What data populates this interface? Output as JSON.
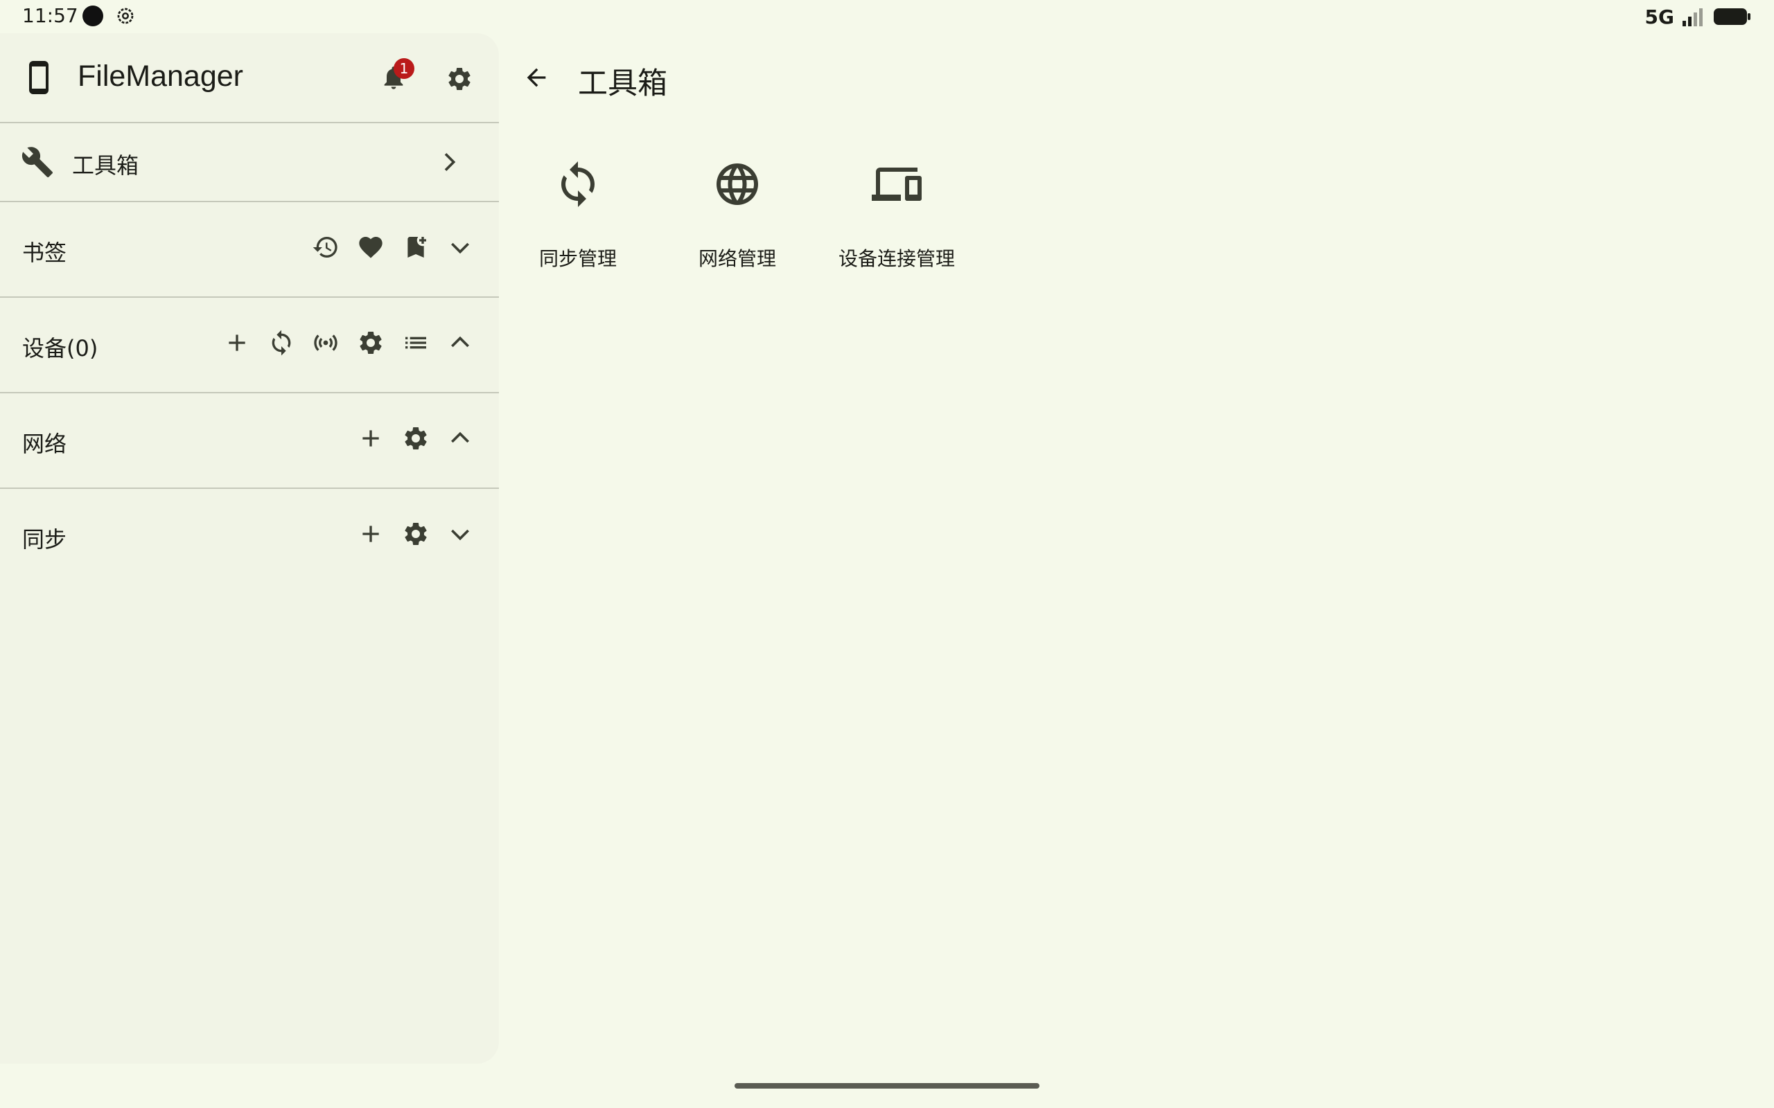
{
  "status_bar": {
    "time": "11:57",
    "network": "5G",
    "icons": [
      "notification-dot-icon",
      "settings-icon",
      "signal-icon",
      "battery-icon"
    ]
  },
  "sidebar": {
    "app_title": "FileManager",
    "notification_count": "1",
    "toolbox_label": "工具箱",
    "sections": {
      "bookmarks": "书签",
      "devices": "设备(0)",
      "network": "网络",
      "sync": "同步"
    }
  },
  "main": {
    "title": "工具箱",
    "tools": [
      {
        "label": "同步管理",
        "icon": "sync-icon"
      },
      {
        "label": "网络管理",
        "icon": "globe-icon"
      },
      {
        "label": "设备连接管理",
        "icon": "devices-icon"
      }
    ]
  },
  "colors": {
    "background": "#f5f9ea",
    "sidebar": "#f1f4e6",
    "icon": "#3b3e33",
    "badge": "#ba1a1a"
  }
}
